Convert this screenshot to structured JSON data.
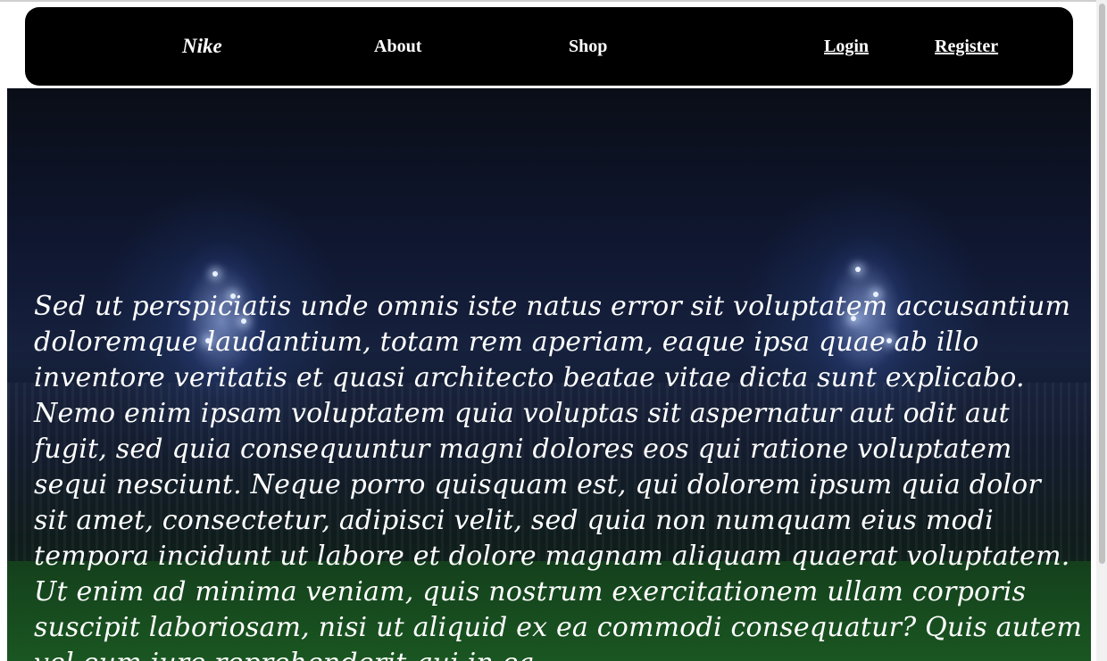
{
  "nav": {
    "brand": "Nike",
    "about": "About",
    "shop": "Shop",
    "login": "Login",
    "register": "Register"
  },
  "hero": {
    "background_icon": "stadium-at-night-image",
    "text": "Sed ut perspiciatis unde omnis iste natus error sit voluptatem accusantium doloremque laudantium, totam rem aperiam, eaque ipsa quae ab illo inventore veritatis et quasi architecto beatae vitae dicta sunt explicabo. Nemo enim ipsam voluptatem quia voluptas sit aspernatur aut odit aut fugit, sed quia consequuntur magni dolores eos qui ratione voluptatem sequi nesciunt. Neque porro quisquam est, qui dolorem ipsum quia dolor sit amet, consectetur, adipisci velit, sed quia non numquam eius modi tempora incidunt ut labore et dolore magnam aliquam quaerat voluptatem. Ut enim ad minima veniam, quis nostrum exercitationem ullam corporis suscipit laboriosam, nisi ut aliquid ex ea commodi consequatur? Quis autem vel eum iure reprehenderit qui in ea"
  },
  "colors": {
    "navbar_bg": "#000000",
    "nav_text": "#ffffff",
    "hero_text": "#ffffff"
  }
}
